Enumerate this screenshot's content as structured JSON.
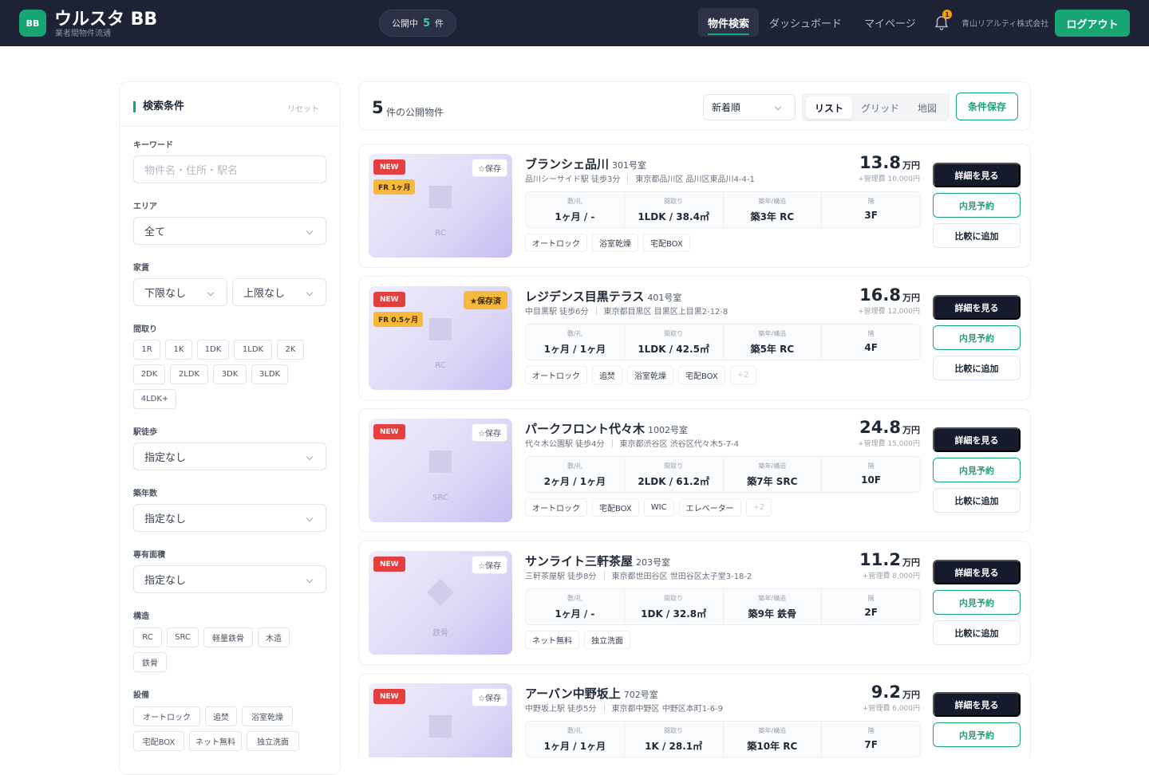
{
  "header": {
    "logo_text": "BB",
    "brand": "ウルスタ BB",
    "brand_sub": "業者間物件流通",
    "published_label": "公開中",
    "published_count": "5",
    "published_unit": "件",
    "nav": [
      "物件検索",
      "ダッシュボード",
      "マイページ"
    ],
    "notification_count": "1",
    "company": "青山リアルティ株式会社",
    "logout": "ログアウト"
  },
  "sidebar": {
    "title": "検索条件",
    "reset": "リセット",
    "keyword_label": "キーワード",
    "keyword_placeholder": "物件名・住所・駅名",
    "area_label": "エリア",
    "area_value": "全て",
    "rent_label": "家賃",
    "rent_min": "下限なし",
    "rent_max": "上限なし",
    "layout_label": "間取り",
    "layouts": [
      "1R",
      "1K",
      "1DK",
      "1LDK",
      "2K",
      "2DK",
      "2LDK",
      "3DK",
      "3LDK",
      "4LDK+"
    ],
    "walk_label": "駅徒歩",
    "walk_value": "指定なし",
    "age_label": "築年数",
    "age_value": "指定なし",
    "area_size_label": "専有面積",
    "area_size_value": "指定なし",
    "structure_label": "構造",
    "structures": [
      "RC",
      "SRC",
      "軽量鉄骨",
      "木造",
      "鉄骨"
    ],
    "facility_label": "設備",
    "facilities": [
      "オートロック",
      "追焚",
      "浴室乾燥",
      "宅配BOX",
      "ネット無料",
      "独立洗面"
    ]
  },
  "results": {
    "count": "5",
    "count_label": "件の公開物件",
    "sort_value": "新着順",
    "views": [
      "リスト",
      "グリッド",
      "地図"
    ],
    "save_conditions": "条件保存"
  },
  "spec_labels": [
    "敷/礼",
    "間取り",
    "築年/構造",
    "階"
  ],
  "actions": {
    "detail": "詳細を見る",
    "visit": "内見予約",
    "compare": "比較に追加"
  },
  "colors": {
    "accent": "#17a673",
    "header_bg": "#1e2235",
    "new_badge": "#e53e3e",
    "fr_badge": "#f6b93b"
  },
  "listings": [
    {
      "name": "ブランシェ品川",
      "room": "301号室",
      "station": "品川シーサイド駅 徒歩3分",
      "address": "東京都品川区 品川区東品川4-4-1",
      "rent": "13.8",
      "rent_unit": "万円",
      "mgmt": "+管理費 10,000円",
      "deposit": "1ヶ月 / -",
      "layout": "1LDK / 38.4㎡",
      "built": "築3年 RC",
      "floor": "3F",
      "structure": "RC",
      "new": "NEW",
      "fr": "FR 1ヶ月",
      "save": "☆保存",
      "tags": [
        "オートロック",
        "浴室乾燥",
        "宅配BOX"
      ]
    },
    {
      "name": "レジデンス目黒テラス",
      "room": "401号室",
      "station": "中目黒駅 徒歩6分",
      "address": "東京都目黒区 目黒区上目黒2-12-8",
      "rent": "16.8",
      "rent_unit": "万円",
      "mgmt": "+管理費 12,000円",
      "deposit": "1ヶ月 / 1ヶ月",
      "layout": "1LDK / 42.5㎡",
      "built": "築5年 RC",
      "floor": "4F",
      "structure": "RC",
      "new": "NEW",
      "fr": "FR 0.5ヶ月",
      "save": "★保存済",
      "tags": [
        "オートロック",
        "追焚",
        "浴室乾燥",
        "宅配BOX",
        "+2"
      ]
    },
    {
      "name": "パークフロント代々木",
      "room": "1002号室",
      "station": "代々木公園駅 徒歩4分",
      "address": "東京都渋谷区 渋谷区代々木5-7-4",
      "rent": "24.8",
      "rent_unit": "万円",
      "mgmt": "+管理費 15,000円",
      "deposit": "2ヶ月 / 1ヶ月",
      "layout": "2LDK / 61.2㎡",
      "built": "築7年 SRC",
      "floor": "10F",
      "structure": "SRC",
      "new": "NEW",
      "fr": "",
      "save": "☆保存",
      "tags": [
        "オートロック",
        "宅配BOX",
        "WIC",
        "エレベーター",
        "+2"
      ]
    },
    {
      "name": "サンライト三軒茶屋",
      "room": "203号室",
      "station": "三軒茶屋駅 徒歩8分",
      "address": "東京都世田谷区 世田谷区太子堂3-18-2",
      "rent": "11.2",
      "rent_unit": "万円",
      "mgmt": "+管理費 8,000円",
      "deposit": "1ヶ月 / -",
      "layout": "1DK / 32.8㎡",
      "built": "築9年 鉄骨",
      "floor": "2F",
      "structure": "鉄骨",
      "new": "NEW",
      "fr": "",
      "save": "☆保存",
      "tags": [
        "ネット無料",
        "独立洗面"
      ]
    },
    {
      "name": "アーバン中野坂上",
      "room": "702号室",
      "station": "中野坂上駅 徒歩5分",
      "address": "東京都中野区 中野区本町1-6-9",
      "rent": "9.2",
      "rent_unit": "万円",
      "mgmt": "+管理費 6,000円",
      "deposit": "1ヶ月 / 1ヶ月",
      "layout": "1K / 28.1㎡",
      "built": "築10年 RC",
      "floor": "7F",
      "structure": "RC",
      "new": "NEW",
      "fr": "",
      "save": "☆保存",
      "tags": []
    }
  ]
}
